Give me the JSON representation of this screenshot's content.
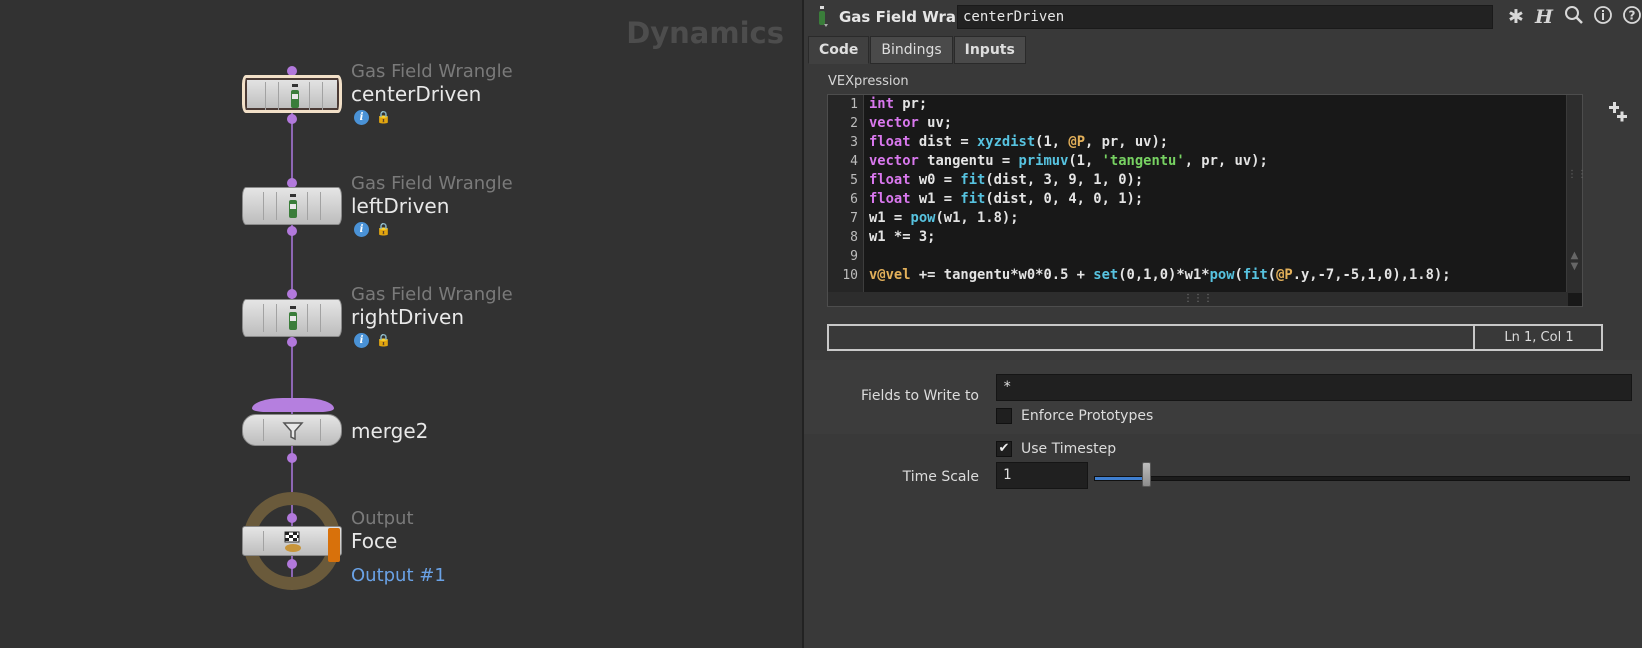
{
  "network": {
    "context_title": "Dynamics",
    "nodes": [
      {
        "type": "Gas Field Wrangle",
        "name": "centerDriven",
        "icon": "vex-wrangle-icon"
      },
      {
        "type": "Gas Field Wrangle",
        "name": "leftDriven",
        "icon": "vex-wrangle-icon"
      },
      {
        "type": "Gas Field Wrangle",
        "name": "rightDriven",
        "icon": "vex-wrangle-icon"
      },
      {
        "type": "",
        "name": "merge2",
        "icon": "funnel-icon"
      },
      {
        "type": "Output",
        "name": "Foce",
        "icon": "checkered-flag-icon",
        "output_label": "Output #1"
      }
    ]
  },
  "params": {
    "header": {
      "node_type": "Gas Field Wrangle",
      "node_name": "centerDriven",
      "tools": [
        "gear-icon",
        "houdini-h-icon",
        "search-icon",
        "info-icon",
        "help-icon"
      ]
    },
    "tabs": [
      "Code",
      "Bindings",
      "Inputs"
    ],
    "active_tab": "Code",
    "code": {
      "label": "VEXpression",
      "line_numbers": [
        "1",
        "2",
        "3",
        "4",
        "5",
        "6",
        "7",
        "8",
        "9",
        "10"
      ],
      "status": "Ln 1, Col 1"
    },
    "fields_to_write": {
      "label": "Fields to Write to",
      "value": "*"
    },
    "enforce_prototypes": {
      "label": "Enforce Prototypes",
      "checked": false
    },
    "use_timestep": {
      "label": "Use Timestep",
      "checked": true
    },
    "time_scale": {
      "label": "Time Scale",
      "value": "1",
      "fraction": 0.09
    }
  }
}
